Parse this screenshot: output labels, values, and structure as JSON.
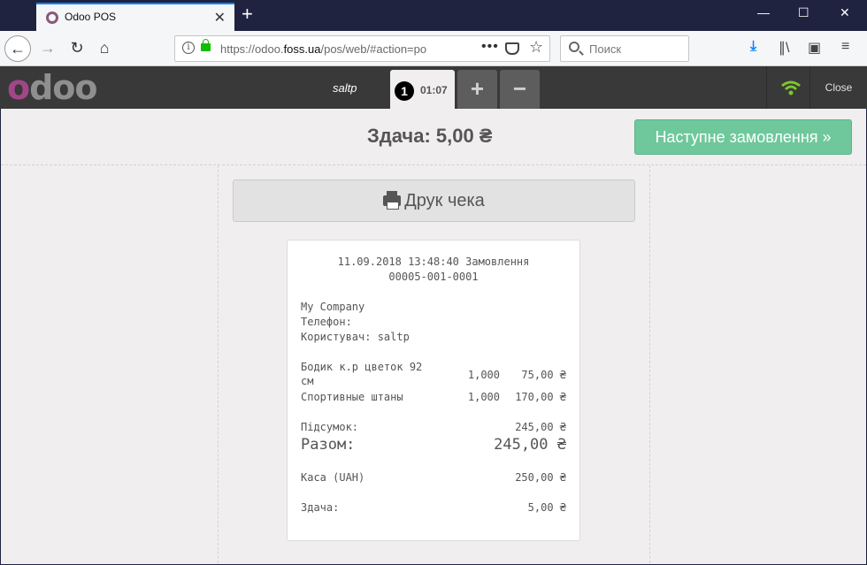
{
  "browser": {
    "tab_title": "Odoo POS",
    "tab_close": "✕",
    "new_tab": "+",
    "url_domain_prefix": "https://odoo.",
    "url_domain": "foss.ua",
    "url_path": "/pos/web/#action=po",
    "search_placeholder": "Поиск",
    "window_controls": {
      "minimize": "—",
      "maximize": "☐",
      "close": "✕"
    }
  },
  "pos": {
    "logo": "odoo",
    "username": "saltp",
    "order": {
      "number": "1",
      "time": "01:07"
    },
    "add_order": "+",
    "remove_order": "−",
    "close": "Close"
  },
  "screen": {
    "change_label": "Здача: 5,00 ₴",
    "next_order": "Наступне замовлення »",
    "print_receipt": "Друк чека"
  },
  "receipt": {
    "header_line1": "11.09.2018 13:48:40 Замовлення",
    "header_line2": "00005-001-0001",
    "company": "My Company",
    "phone": "Телефон:",
    "user": "Користувач: saltp",
    "lines": [
      {
        "name1": "Бодик к.р цветок 92",
        "name2": "см",
        "qty": "1,000",
        "price": "75,00 ₴"
      },
      {
        "name1": "Спортивные штаны",
        "name2": "",
        "qty": "1,000",
        "price": "170,00 ₴"
      }
    ],
    "subtotal_label": "Підсумок:",
    "subtotal_value": "245,00 ₴",
    "total_label": "Разом:",
    "total_value": "245,00 ₴",
    "payment_label": "Каса (UAH)",
    "payment_value": "250,00 ₴",
    "change_label": "Здача:",
    "change_value": "5,00 ₴"
  },
  "colors": {
    "accent_green": "#6ec89b",
    "odoo_purple": "#a24689",
    "header_dark": "#393939",
    "wifi_green": "#7bc62d"
  }
}
